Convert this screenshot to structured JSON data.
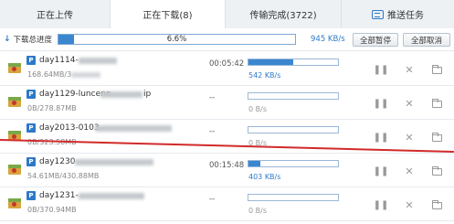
{
  "tabs": [
    {
      "label": "正在上传"
    },
    {
      "label": "正在下载(8)"
    },
    {
      "label": "传输完成(3722)"
    },
    {
      "label": "推送任务"
    }
  ],
  "summary": {
    "label": "下载总进度",
    "progress_text": "6.6%",
    "progress_value": 0.066,
    "speed": "945 KB/s",
    "pause_all": "全部暂停",
    "cancel_all": "全部取消"
  },
  "downloads": [
    {
      "name": "day1114-",
      "size": "168.64MB/3",
      "time": "00:05:42",
      "progress": 0.5,
      "speed": "542 KB/s"
    },
    {
      "name": "day1129-luncene",
      "name_tail": "ip",
      "size": "0B/278.87MB",
      "time": "--",
      "progress": 0.0,
      "speed": "0 B/s"
    },
    {
      "name": "day2013-0103",
      "size": "0B/323.58MB",
      "time": "--",
      "progress": 0.0,
      "speed": "0 B/s"
    },
    {
      "name": "day1230",
      "size": "54.61MB/430.88MB",
      "time": "00:15:48",
      "progress": 0.13,
      "speed": "403 KB/s"
    },
    {
      "name": "day1231-",
      "size": "0B/370.94MB",
      "time": "--",
      "progress": 0.0,
      "speed": "0 B/s"
    }
  ],
  "icons": {
    "file": "archive-file-icon",
    "pause": "pause-icon",
    "delete": "close-icon",
    "folder": "folder-icon"
  }
}
